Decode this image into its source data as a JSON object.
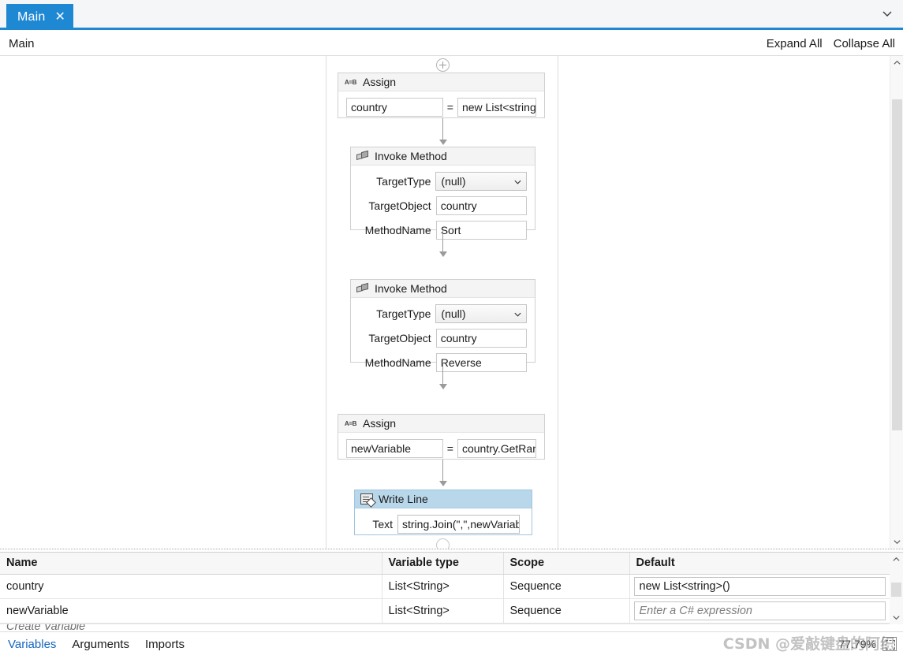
{
  "tab": {
    "label": "Main",
    "close_icon": "close-icon",
    "overflow_icon": "chevron-down-icon"
  },
  "header": {
    "breadcrumb": "Main",
    "expand_all": "Expand All",
    "collapse_all": "Collapse All"
  },
  "canvas": {
    "add_top_icon": "plus-circle-icon",
    "add_bottom_icon": "plus-circle-icon",
    "activities": [
      {
        "type": "Assign",
        "icon": "assign-ab-icon",
        "title": "Assign",
        "left_value": "country",
        "operator": "=",
        "right_value": "new List<string>("
      },
      {
        "type": "InvokeMethod",
        "icon": "invoke-method-icon",
        "title": "Invoke Method",
        "properties": [
          {
            "label": "TargetType",
            "value": "(null)",
            "control": "combobox"
          },
          {
            "label": "TargetObject",
            "value": "country",
            "control": "textbox"
          },
          {
            "label": "MethodName",
            "value": "Sort",
            "control": "textbox"
          }
        ]
      },
      {
        "type": "InvokeMethod",
        "icon": "invoke-method-icon",
        "title": "Invoke Method",
        "properties": [
          {
            "label": "TargetType",
            "value": "(null)",
            "control": "combobox"
          },
          {
            "label": "TargetObject",
            "value": "country",
            "control": "textbox"
          },
          {
            "label": "MethodName",
            "value": "Reverse",
            "control": "textbox"
          }
        ]
      },
      {
        "type": "Assign",
        "icon": "assign-ab-icon",
        "title": "Assign",
        "left_value": "newVariable",
        "operator": "=",
        "right_value": "country.GetRange"
      },
      {
        "type": "WriteLine",
        "icon": "write-line-icon",
        "title": "Write Line",
        "selected": true,
        "properties": [
          {
            "label": "Text",
            "value": "string.Join(\",\",newVariable.",
            "control": "textbox"
          }
        ]
      }
    ]
  },
  "variables_panel": {
    "columns": [
      "Name",
      "Variable type",
      "Scope",
      "Default"
    ],
    "rows": [
      {
        "name": "country",
        "type": "List<String>",
        "scope": "Sequence",
        "default_value": "new List<string>()",
        "default_is_placeholder": false
      },
      {
        "name": "newVariable",
        "type": "List<String>",
        "scope": "Sequence",
        "default_value": "Enter a C# expression",
        "default_is_placeholder": true
      }
    ],
    "create_row_label": "Create Variable"
  },
  "status": {
    "tabs": [
      {
        "label": "Variables",
        "active": true
      },
      {
        "label": "Arguments",
        "active": false
      },
      {
        "label": "Imports",
        "active": false
      }
    ],
    "zoom_level": "77.79%",
    "fit_icon": "fit-to-screen-icon"
  },
  "watermark": {
    "text": "CSDN @爱敲键盘的阿织"
  },
  "colors": {
    "accent": "#1e88d3",
    "selected_header": "#b9d7ea",
    "link": "#1565c0"
  }
}
